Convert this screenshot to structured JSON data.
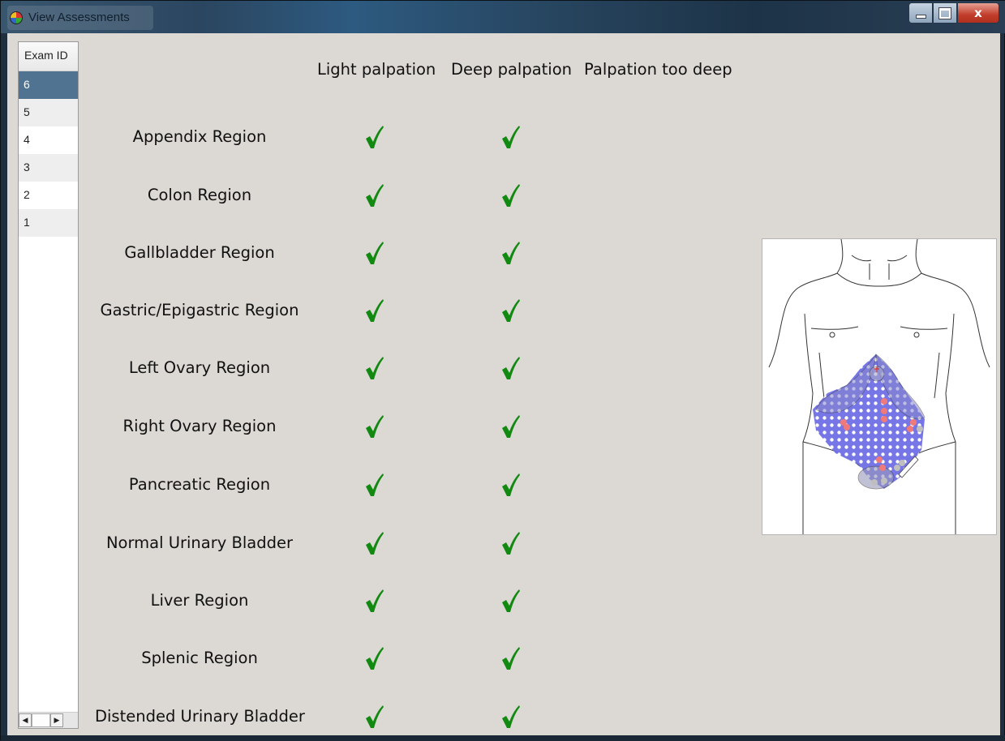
{
  "window": {
    "title": "View Assessments",
    "close_glyph": "x"
  },
  "exams": {
    "header": "Exam ID",
    "ids": [
      "6",
      "5",
      "4",
      "3",
      "2",
      "1"
    ],
    "selected": "6"
  },
  "columns": {
    "light": "Light palpation",
    "deep": "Deep palpation",
    "too_deep": "Palpation too deep"
  },
  "regions": [
    {
      "label": "Appendix Region",
      "light": true,
      "deep": true,
      "too_deep": false
    },
    {
      "label": "Colon Region",
      "light": true,
      "deep": true,
      "too_deep": false
    },
    {
      "label": "Gallbladder Region",
      "light": true,
      "deep": true,
      "too_deep": false
    },
    {
      "label": "Gastric/Epigastric Region",
      "light": true,
      "deep": true,
      "too_deep": false
    },
    {
      "label": "Left Ovary Region",
      "light": true,
      "deep": true,
      "too_deep": false
    },
    {
      "label": "Right Ovary Region",
      "light": true,
      "deep": true,
      "too_deep": false
    },
    {
      "label": "Pancreatic Region",
      "light": true,
      "deep": true,
      "too_deep": false
    },
    {
      "label": "Normal Urinary Bladder",
      "light": true,
      "deep": true,
      "too_deep": false
    },
    {
      "label": "Liver Region",
      "light": true,
      "deep": true,
      "too_deep": false
    },
    {
      "label": "Splenic Region",
      "light": true,
      "deep": true,
      "too_deep": false
    },
    {
      "label": "Distended Urinary Bladder",
      "light": true,
      "deep": true,
      "too_deep": false
    }
  ],
  "colors": {
    "check": "#128a12",
    "selection": "#4f7391",
    "palpation_dot": "#ffffff",
    "palpation_area": "#6f6fe6",
    "deep_point": "#f07a7a",
    "body_line": "#333333"
  },
  "icons": {
    "app": "app-icon",
    "check": "check-icon",
    "minimize": "minimize-icon",
    "maximize": "maximize-icon",
    "close": "close-icon"
  }
}
